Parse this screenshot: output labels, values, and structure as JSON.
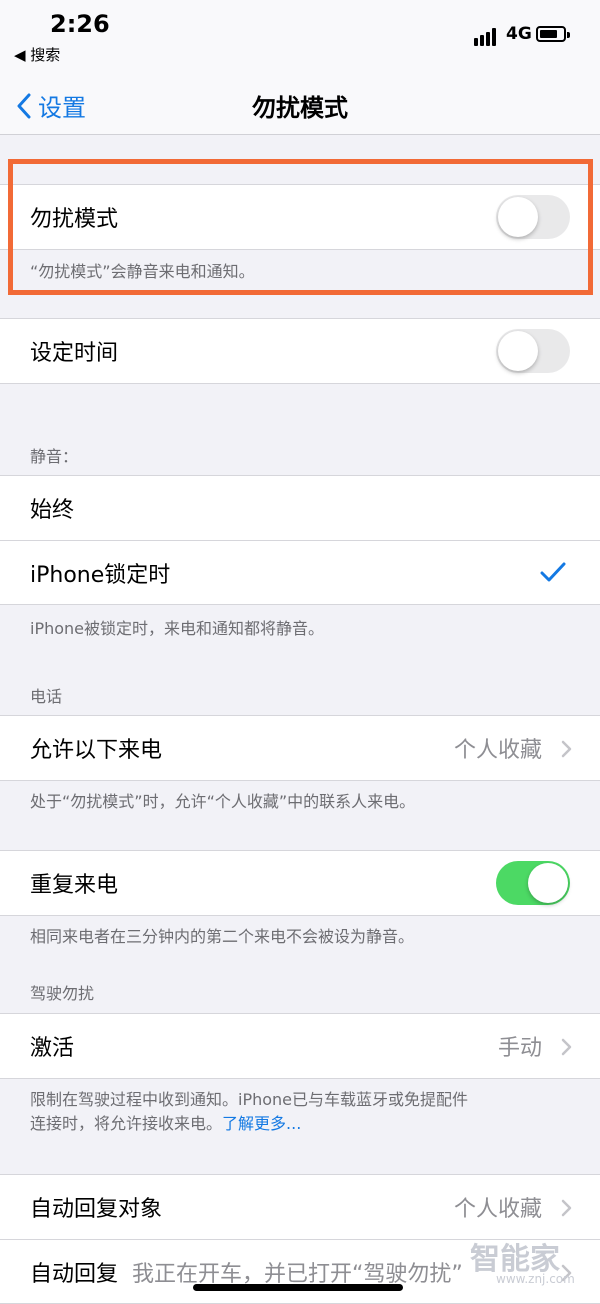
{
  "status_bar": {
    "time": "2:26",
    "back_app": "◀ 搜索",
    "network": "4G"
  },
  "nav": {
    "back_label": "设置",
    "title": "勿扰模式"
  },
  "dnd": {
    "label": "勿扰模式",
    "enabled": false,
    "footnote": "“勿扰模式”会静音来电和通知。"
  },
  "scheduled": {
    "label": "设定时间",
    "enabled": false
  },
  "silence": {
    "header": "静音：",
    "options": [
      {
        "label": "始终",
        "selected": false
      },
      {
        "label": "iPhone锁定时",
        "selected": true
      }
    ],
    "footnote": "iPhone被锁定时，来电和通知都将静音。"
  },
  "phone": {
    "header": "电话",
    "allow_calls_label": "允许以下来电",
    "allow_calls_value": "个人收藏",
    "footnote": "处于“勿扰模式”时，允许“个人收藏”中的联系人来电。"
  },
  "repeated": {
    "label": "重复来电",
    "enabled": true,
    "footnote": "相同来电者在三分钟内的第二个来电不会被设为静音。"
  },
  "driving": {
    "header": "驾驶勿扰",
    "activate_label": "激活",
    "activate_value": "手动",
    "footnote_line1": "限制在驾驶过程中收到通知。iPhone已与车载蓝牙或免提配件",
    "footnote_line2": "连接时，将允许接收来电。",
    "learn_more": "了解更多..."
  },
  "auto_reply": {
    "to_label": "自动回复对象",
    "to_value": "个人收藏",
    "reply_label": "自动回复",
    "reply_value": "我正在开车，并已打开“驾驶勿扰”"
  },
  "watermark": {
    "text": "智能家",
    "url": "www.znj.com"
  },
  "colors": {
    "accent": "#1479e3",
    "toggle_on": "#4cd964",
    "highlight": "#f26a36"
  }
}
